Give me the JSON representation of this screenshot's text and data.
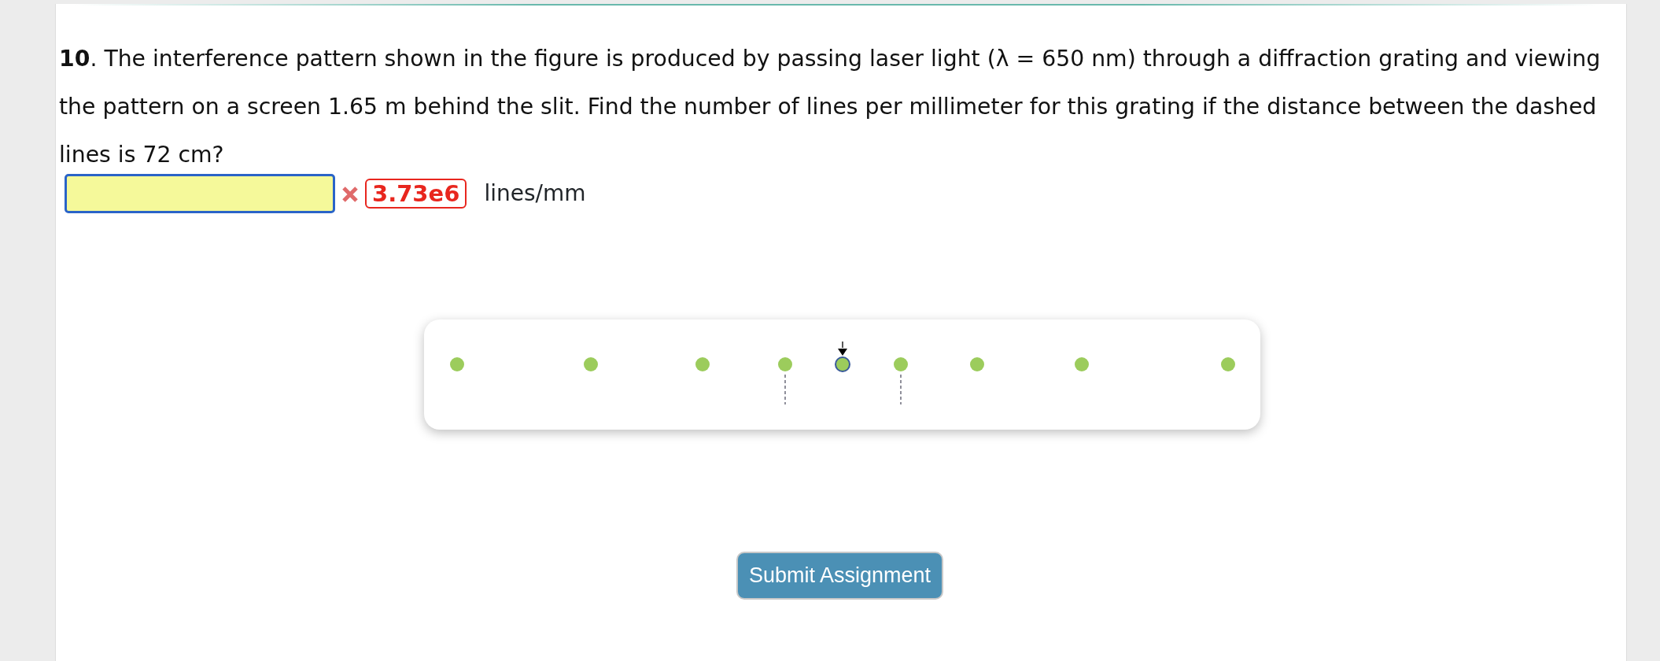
{
  "question": {
    "text": "**10**. The interference pattern shown in the figure is produced by passing laser light (λ = 650 nm) through a diffraction grating and viewing the pattern on a screen 1.65 m behind the slit. Find the number of lines per millimeter for this grating if the distance between the dashed lines is 72 cm?"
  },
  "answer": {
    "correct": false,
    "shown_answer": "3.73e6",
    "units": "lines/mm"
  },
  "submit_button": {
    "label": "Submit Assignment"
  }
}
